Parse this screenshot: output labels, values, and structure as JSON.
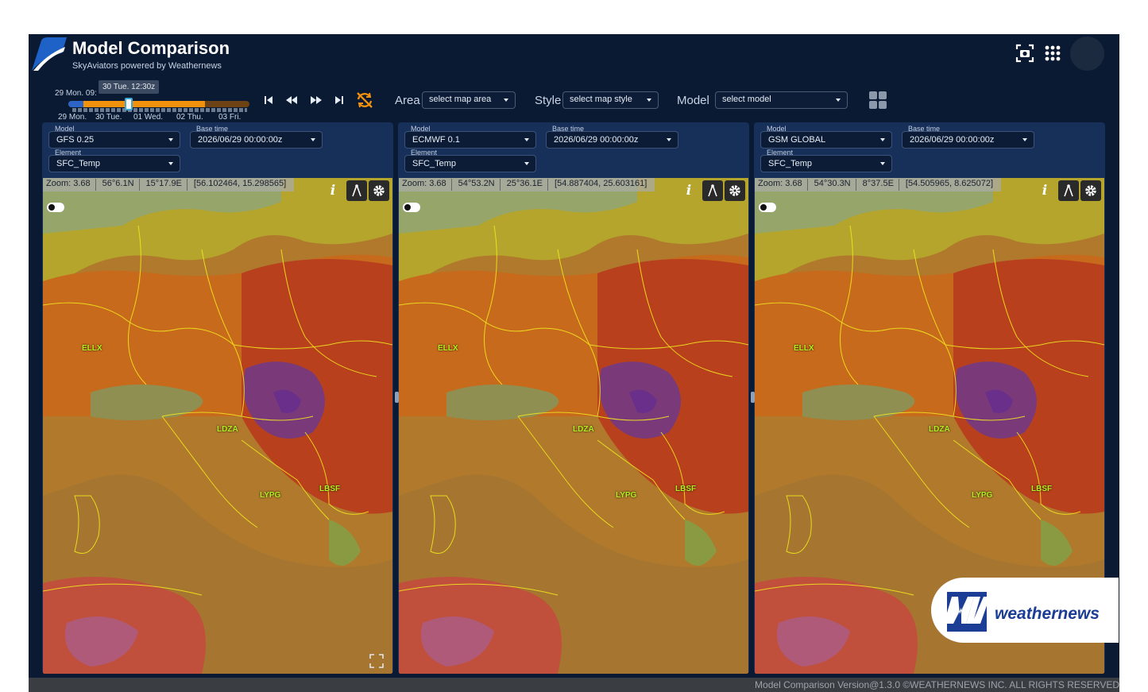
{
  "header": {
    "title": "Model Comparison",
    "subtitle": "SkyAviators powered by Weathernews"
  },
  "icons": {
    "logo": "skyaviators-logo",
    "screenshot": "camera-capture-icon",
    "apps": "app-grid-icon",
    "avatar": "user-avatar"
  },
  "timeline": {
    "current_label": "29 Mon. 09:",
    "tooltip": "30 Tue. 12:30z",
    "days": [
      "29 Mon.",
      "30 Tue.",
      "01 Wed.",
      "02 Thu.",
      "03 Fri."
    ],
    "progress": 0.36
  },
  "playback": [
    "first",
    "previous",
    "next",
    "last",
    "sync-off"
  ],
  "controls": {
    "area_label": "Area",
    "area_placeholder": "select map area",
    "style_label": "Style",
    "style_placeholder": "select map style",
    "model_label": "Model",
    "model_placeholder": "select model"
  },
  "panels": [
    {
      "model_label": "Model",
      "model": "GFS 0.25",
      "base_label": "Base time",
      "base_time": "2026/06/29 00:00:00z",
      "element_label": "Element",
      "element": "SFC_Temp",
      "zoom": "Zoom: 3.68",
      "lat": "56°6.1N",
      "lon": "15°17.9E",
      "coord": "[56.102464, 15.298565]"
    },
    {
      "model_label": "Model",
      "model": "ECMWF 0.1",
      "base_label": "Base time",
      "base_time": "2026/06/29 00:00:00z",
      "element_label": "Element",
      "element": "SFC_Temp",
      "zoom": "Zoom: 3.68",
      "lat": "54°53.2N",
      "lon": "25°36.1E",
      "coord": "[54.887404, 25.603161]"
    },
    {
      "model_label": "Model",
      "model": "GSM GLOBAL",
      "base_label": "Base time",
      "base_time": "2026/06/29 00:00:00z",
      "element_label": "Element",
      "element": "SFC_Temp",
      "zoom": "Zoom: 3.68",
      "lat": "54°30.3N",
      "lon": "8°37.5E",
      "coord": "[54.505965, 8.625072]"
    }
  ],
  "airports": [
    "ELLX",
    "LDZA",
    "LYPG",
    "LBSF"
  ],
  "brand": {
    "text": "weathernews",
    "mark": "WN"
  },
  "footer": "Model Comparison  Version@1.3.0  ©WEATHERNEWS INC. ALL RIGHTS RESERVED",
  "colors": {
    "background": "#0b1a33",
    "panel": "#17305a",
    "timeline_fill": "#f2920c",
    "handle": "#3ea8d8",
    "airport_label": "#b6f01e",
    "border_lines": "#f0e61e"
  }
}
